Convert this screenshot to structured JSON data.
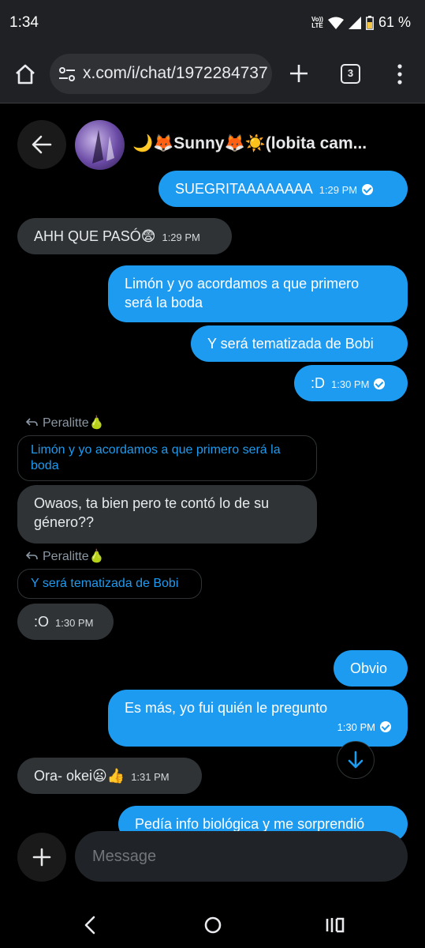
{
  "status": {
    "time": "1:34",
    "battery": "61 %",
    "volte_line1": "Vo))",
    "volte_line2": "LTE"
  },
  "browser": {
    "url": "x.com/i/chat/1972284737",
    "tab_count": "3"
  },
  "chat": {
    "title": "🌙🦊Sunny🦊☀️(lobita cam..."
  },
  "messages": {
    "m1": {
      "text": "SUEGRITAAAAAAAA",
      "time": "1:29 PM"
    },
    "m2": {
      "text": "AHH QUE PASÓ😨",
      "time": "1:29 PM"
    },
    "m3": {
      "line1": "Limón y yo acordamos a que primero",
      "line2": "será la boda"
    },
    "m4": {
      "text": "Y será tematizada de Bobi"
    },
    "m5": {
      "text": ":D",
      "time": "1:30 PM"
    },
    "r1": {
      "label": "Peralitte🍐",
      "quote_line1": "Limón y yo acordamos a que primero será la",
      "quote_line2": "boda"
    },
    "m6": {
      "line1": "Owaos, ta bien pero te contó lo de su",
      "line2": "género??"
    },
    "r2": {
      "label": "Peralitte🍐",
      "quote": "Y será tematizada de Bobi"
    },
    "m7": {
      "text": ":O",
      "time": "1:30 PM"
    },
    "m8": {
      "text": "Obvio"
    },
    "m9": {
      "text": "Es más, yo fui quién le pregunto",
      "time": "1:30 PM"
    },
    "m10": {
      "text": "Ora- okei😦👍",
      "time": "1:31 PM"
    },
    "m11": {
      "text": "Pedía info biológica y me sorprendió"
    }
  },
  "composer": {
    "placeholder": "Message"
  },
  "colors": {
    "accent": "#1d9bf0",
    "incoming": "#2f3336",
    "background": "#000000"
  }
}
